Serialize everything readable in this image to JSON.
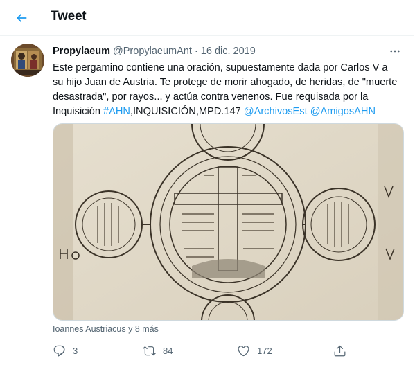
{
  "header": {
    "title": "Tweet"
  },
  "tweet": {
    "author_name": "Propylaeum",
    "author_handle": "@PropylaeumAnt",
    "separator": "·",
    "date": "16 dic. 2019",
    "text_before": "Este pergamino contiene una oración, supuestamente dada por Carlos V a su hijo Juan de Austria. Te protege de morir ahogado, de heridas, de \"muerte desastrada\", por rayos... y actúa contra venenos. Fue requisada por la Inquisición ",
    "hashtag": "#AHN",
    "text_middle": ",INQUISICIÓN,MPD.147 ",
    "mention1": "@ArchivosEst",
    "mention2": "@AmigosAHN",
    "liked_by": "Ioannes Austriacus y 8 más"
  },
  "actions": {
    "replies": "3",
    "retweets": "84",
    "likes": "172"
  },
  "colors": {
    "accent": "#1d9bf0",
    "secondary_text": "#536471",
    "primary_text": "#0f1419"
  },
  "icons": {
    "back": "arrow-left-icon",
    "more": "more-horizontal-icon",
    "reply": "reply-icon",
    "retweet": "retweet-icon",
    "like": "heart-icon",
    "share": "share-icon"
  }
}
